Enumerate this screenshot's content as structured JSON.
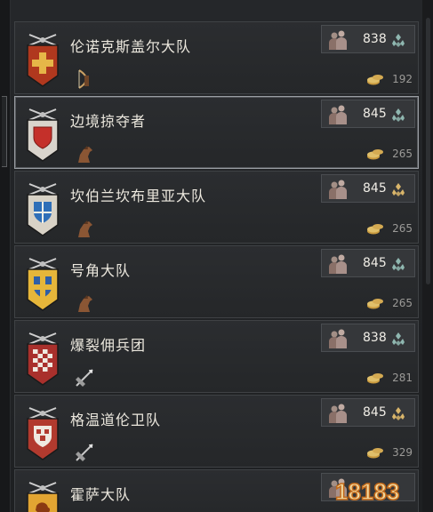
{
  "units": [
    {
      "name": "伦诺克斯盖尔大队",
      "power": "838",
      "gem": "teal",
      "upkeep": "192",
      "unit_type": "archer",
      "banner_bg": "#b0381e",
      "banner_symbol": "cross",
      "selected": false
    },
    {
      "name": "边境掠夺者",
      "power": "845",
      "gem": "teal",
      "upkeep": "265",
      "unit_type": "cavalry",
      "banner_bg": "#d9d4cc",
      "banner_symbol": "shield-red",
      "selected": true
    },
    {
      "name": "坎伯兰坎布里亚大队",
      "power": "845",
      "gem": "gold",
      "upkeep": "265",
      "unit_type": "cavalry",
      "banner_bg": "#d8d2c6",
      "banner_symbol": "shield-blue",
      "selected": false
    },
    {
      "name": "号角大队",
      "power": "845",
      "gem": "teal",
      "upkeep": "265",
      "unit_type": "cavalry",
      "banner_bg": "#e6b63a",
      "banner_symbol": "shield-gold",
      "selected": false
    },
    {
      "name": "爆裂佣兵团",
      "power": "838",
      "gem": "teal",
      "upkeep": "281",
      "unit_type": "spear",
      "banner_bg": "#a9302c",
      "banner_symbol": "checker",
      "selected": false
    },
    {
      "name": "格温道伦卫队",
      "power": "845",
      "gem": "gold",
      "upkeep": "329",
      "unit_type": "spear",
      "banner_bg": "#b23a2e",
      "banner_symbol": "checker-shield",
      "selected": false
    },
    {
      "name": "霍萨大队",
      "power": "",
      "gem": "",
      "upkeep": "",
      "unit_type": "",
      "banner_bg": "#e2a532",
      "banner_symbol": "lion",
      "selected": false
    }
  ],
  "colors": {
    "teal_gem": "#8fb7b0",
    "gold_gem": "#d9b56a"
  },
  "watermark": {
    "text": "18183"
  }
}
